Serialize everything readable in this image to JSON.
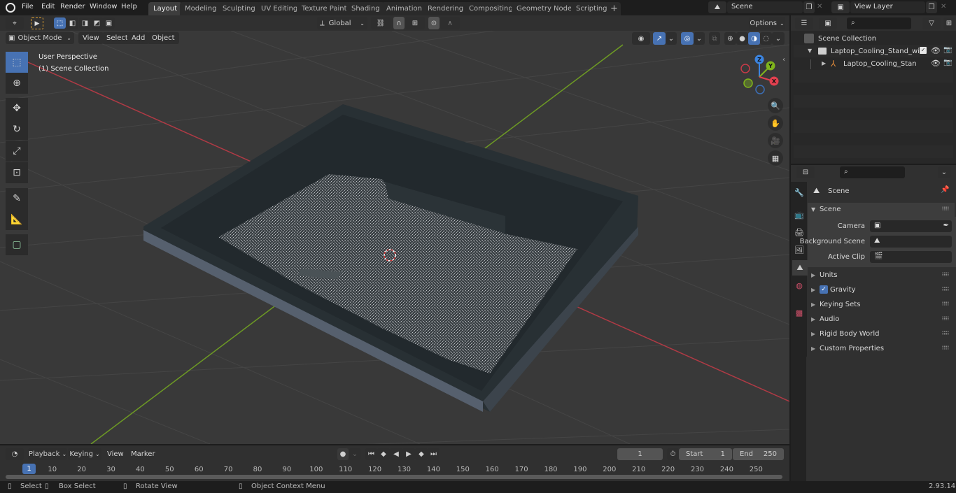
{
  "app": {
    "menu": [
      "File",
      "Edit",
      "Render",
      "Window",
      "Help"
    ],
    "workspaces": [
      {
        "label": "Layout",
        "active": true
      },
      {
        "label": "Modeling"
      },
      {
        "label": "Sculpting"
      },
      {
        "label": "UV Editing"
      },
      {
        "label": "Texture Paint"
      },
      {
        "label": "Shading"
      },
      {
        "label": "Animation"
      },
      {
        "label": "Rendering"
      },
      {
        "label": "Compositing"
      },
      {
        "label": "Geometry Nodes"
      },
      {
        "label": "Scripting"
      }
    ],
    "add_workspace": "+",
    "scene_field": "Scene",
    "view_layer_field": "View Layer"
  },
  "viewport": {
    "mode": "Object Mode",
    "menus": [
      "View",
      "Select",
      "Add",
      "Object"
    ],
    "transform_orientation": "Global",
    "options_label": "Options",
    "overlay_title": "User Perspective",
    "overlay_subtitle": "(1) Scene Collection",
    "tools": [
      {
        "name": "select-box-tool",
        "icon": "select-box-icon"
      },
      {
        "name": "cursor-tool",
        "icon": "cursor-icon"
      },
      {
        "name": "move-tool",
        "icon": "move-icon"
      },
      {
        "name": "rotate-tool",
        "icon": "rotate-icon"
      },
      {
        "name": "scale-tool",
        "icon": "scale-icon"
      },
      {
        "name": "transform-tool",
        "icon": "transform-icon"
      },
      {
        "name": "annotate-tool",
        "icon": "annotate-icon"
      },
      {
        "name": "measure-tool",
        "icon": "measure-icon"
      },
      {
        "name": "add-cube-tool",
        "icon": "add-cube-icon"
      }
    ],
    "gizmo_axes": {
      "x": "X",
      "y": "Y",
      "z": "Z"
    },
    "axis_colors": {
      "x": "#e2404f",
      "y": "#7fb41c",
      "z": "#3b84e0"
    }
  },
  "outliner": {
    "root": "Scene Collection",
    "items": [
      {
        "label": "Laptop_Cooling_Stand_with_E",
        "type": "collection",
        "expanded": true,
        "checked": true
      },
      {
        "label": "Laptop_Cooling_Stand_w",
        "type": "armature",
        "expanded": false
      }
    ]
  },
  "properties": {
    "context": "Scene",
    "section": "Scene",
    "fields": [
      {
        "label": "Camera",
        "value": ""
      },
      {
        "label": "Background Scene",
        "value": ""
      },
      {
        "label": "Active Clip",
        "value": ""
      }
    ],
    "panels": [
      {
        "label": "Units"
      },
      {
        "label": "Gravity",
        "checkbox": true,
        "checked": true
      },
      {
        "label": "Keying Sets"
      },
      {
        "label": "Audio"
      },
      {
        "label": "Rigid Body World"
      },
      {
        "label": "Custom Properties"
      }
    ]
  },
  "timeline": {
    "menus": [
      "Playback",
      "Keying",
      "View",
      "Marker"
    ],
    "current_frame": "1",
    "start_label": "Start",
    "start": "1",
    "end_label": "End",
    "end": "250",
    "playhead": "1",
    "ticks": [
      "10",
      "20",
      "30",
      "40",
      "50",
      "60",
      "70",
      "80",
      "90",
      "100",
      "110",
      "120",
      "130",
      "140",
      "150",
      "160",
      "170",
      "180",
      "190",
      "200",
      "210",
      "220",
      "230",
      "240",
      "250"
    ]
  },
  "statusbar": {
    "hints": [
      "Select",
      "Box Select",
      "Rotate View",
      "Object Context Menu"
    ],
    "version": "2.93.14"
  }
}
